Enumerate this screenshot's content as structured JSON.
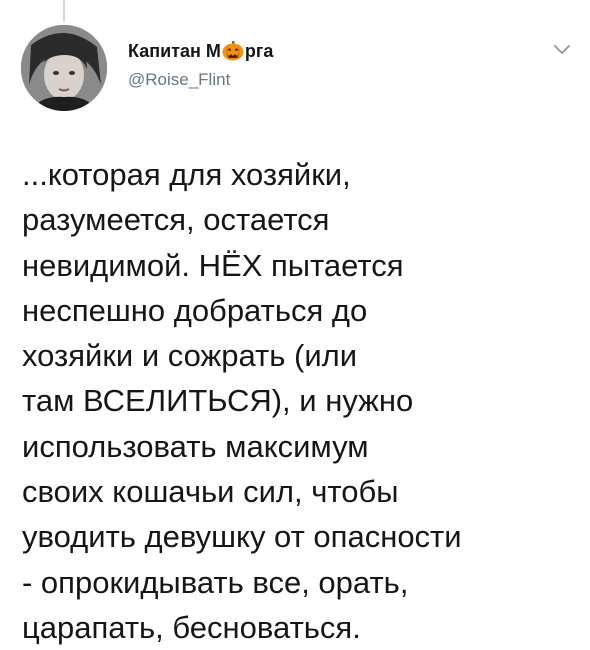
{
  "tweet": {
    "author": {
      "name_before_emoji": "Капитан М",
      "name_emoji": "jack-o-lantern",
      "name_after_emoji": "рга",
      "handle": "@Roise_Flint"
    },
    "menu_icon": "chevron-down-icon",
    "text_lines": [
      "...которая для хозяйки,",
      "разумеется, остается",
      "невидимой. НЁХ пытается",
      "неспешно добраться до",
      "хозяйки и сожрать (или",
      "там ВСЕЛИТЬСЯ), и нужно",
      "использовать максимум",
      "своих кошачьи сил, чтобы",
      "уводить девушку от опасности",
      "- опрокидывать все, орать,",
      "царапать, бесноваться."
    ]
  },
  "colors": {
    "text": "#14171a",
    "secondary": "#657786",
    "thread_line": "#cfd9de",
    "pumpkin": "#f4900c"
  }
}
